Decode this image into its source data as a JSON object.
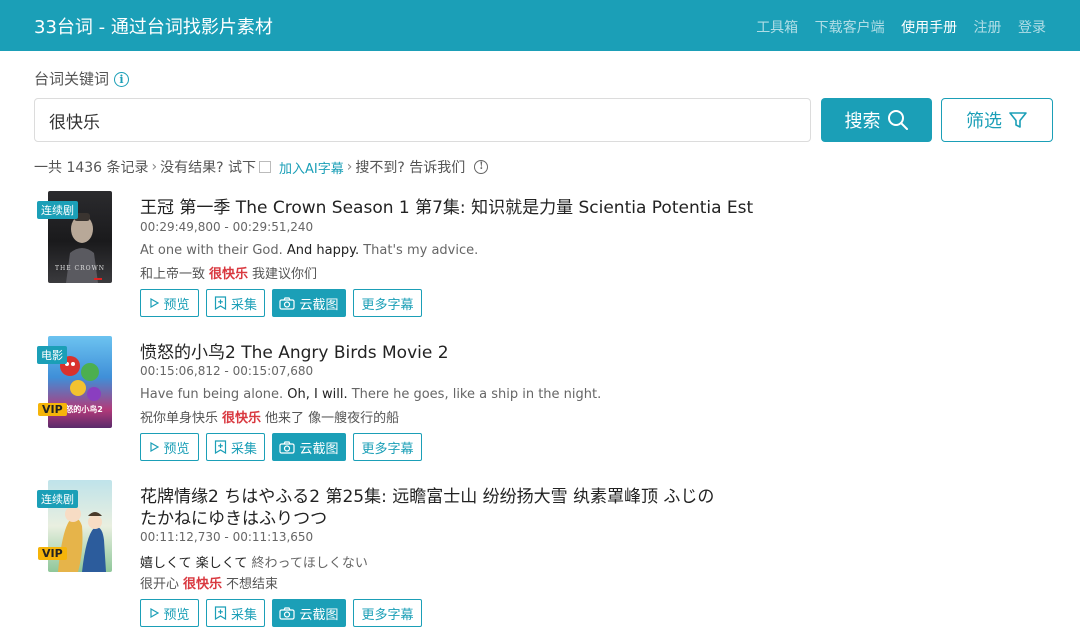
{
  "header": {
    "brand": "33台词 - 通过台词找影片素材",
    "nav": [
      "工具箱",
      "下载客户端",
      "使用手册",
      "注册",
      "登录"
    ]
  },
  "search": {
    "label": "台词关键词",
    "value": "很快乐",
    "search_button": "搜索",
    "filter_button": "筛选"
  },
  "stats": {
    "total": "一共 1436 条记录",
    "no_result": "没有结果? 试下",
    "ai_link": "加入AI字幕",
    "not_found": "搜不到? 告诉我们"
  },
  "actions": {
    "preview": "预览",
    "collect": "采集",
    "screenshot": "云截图",
    "more": "更多字幕"
  },
  "results": [
    {
      "type_badge": "连续剧",
      "vip": "",
      "title": "王冠 第一季 The Crown Season 1 第7集: 知识就是力量 Scientia Potentia Est",
      "title_line2": "",
      "time": "00:29:49,800 - 00:29:51,240",
      "en_before": "At one with their God. ",
      "en_hl": "And happy.",
      "en_after": " That's my advice.",
      "zh_before": "和上帝一致",
      "zh_hl": "很快乐",
      "zh_after": "我建议你们",
      "poster_text": "THE CROWN"
    },
    {
      "type_badge": "电影",
      "vip": "VIP",
      "title": "愤怒的小鸟2 The Angry Birds Movie 2",
      "title_line2": "",
      "time": "00:15:06,812 - 00:15:07,680",
      "en_before": "Have fun being alone. ",
      "en_hl": "Oh, I will.",
      "en_after": " There he goes, like a ship in the night.",
      "zh_before": "祝你单身快乐",
      "zh_hl": "很快乐",
      "zh_after": "他来了 像一艘夜行的船",
      "poster_text": "愤怒的小鸟2"
    },
    {
      "type_badge": "连续剧",
      "vip": "VIP",
      "title": "花牌情缘2 ちはやふる2 第25集: 远瞻富士山 纷纷扬大雪 纨素罩峰顶 ふじの",
      "title_line2": "たかねにゆきはふりつつ",
      "time": "00:11:12,730 - 00:11:13,650",
      "en_before": "",
      "en_hl": "嬉しくて  楽しくて",
      "en_after": " 終わってほしくない",
      "zh_before": "很开心",
      "zh_hl": "很快乐",
      "zh_after": "不想结束",
      "poster_text": ""
    }
  ],
  "colors": {
    "primary": "#1b9fb7",
    "highlight": "#d9383f",
    "vip": "#f5b40a"
  }
}
